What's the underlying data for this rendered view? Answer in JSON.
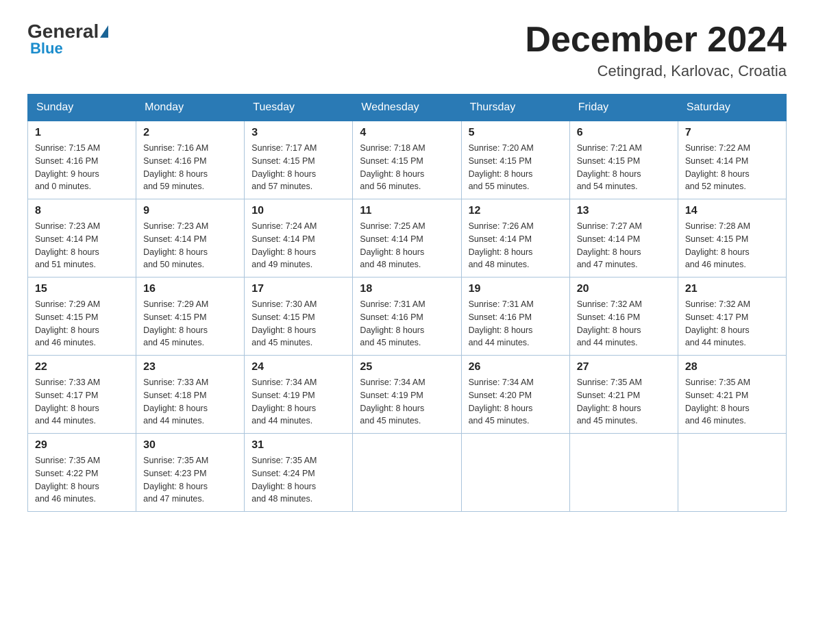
{
  "logo": {
    "general": "General",
    "blue": "Blue"
  },
  "title": {
    "month_year": "December 2024",
    "location": "Cetingrad, Karlovac, Croatia"
  },
  "headers": [
    "Sunday",
    "Monday",
    "Tuesday",
    "Wednesday",
    "Thursday",
    "Friday",
    "Saturday"
  ],
  "weeks": [
    [
      {
        "day": "1",
        "sunrise": "7:15 AM",
        "sunset": "4:16 PM",
        "daylight": "9 hours and 0 minutes."
      },
      {
        "day": "2",
        "sunrise": "7:16 AM",
        "sunset": "4:16 PM",
        "daylight": "8 hours and 59 minutes."
      },
      {
        "day": "3",
        "sunrise": "7:17 AM",
        "sunset": "4:15 PM",
        "daylight": "8 hours and 57 minutes."
      },
      {
        "day": "4",
        "sunrise": "7:18 AM",
        "sunset": "4:15 PM",
        "daylight": "8 hours and 56 minutes."
      },
      {
        "day": "5",
        "sunrise": "7:20 AM",
        "sunset": "4:15 PM",
        "daylight": "8 hours and 55 minutes."
      },
      {
        "day": "6",
        "sunrise": "7:21 AM",
        "sunset": "4:15 PM",
        "daylight": "8 hours and 54 minutes."
      },
      {
        "day": "7",
        "sunrise": "7:22 AM",
        "sunset": "4:14 PM",
        "daylight": "8 hours and 52 minutes."
      }
    ],
    [
      {
        "day": "8",
        "sunrise": "7:23 AM",
        "sunset": "4:14 PM",
        "daylight": "8 hours and 51 minutes."
      },
      {
        "day": "9",
        "sunrise": "7:23 AM",
        "sunset": "4:14 PM",
        "daylight": "8 hours and 50 minutes."
      },
      {
        "day": "10",
        "sunrise": "7:24 AM",
        "sunset": "4:14 PM",
        "daylight": "8 hours and 49 minutes."
      },
      {
        "day": "11",
        "sunrise": "7:25 AM",
        "sunset": "4:14 PM",
        "daylight": "8 hours and 48 minutes."
      },
      {
        "day": "12",
        "sunrise": "7:26 AM",
        "sunset": "4:14 PM",
        "daylight": "8 hours and 48 minutes."
      },
      {
        "day": "13",
        "sunrise": "7:27 AM",
        "sunset": "4:14 PM",
        "daylight": "8 hours and 47 minutes."
      },
      {
        "day": "14",
        "sunrise": "7:28 AM",
        "sunset": "4:15 PM",
        "daylight": "8 hours and 46 minutes."
      }
    ],
    [
      {
        "day": "15",
        "sunrise": "7:29 AM",
        "sunset": "4:15 PM",
        "daylight": "8 hours and 46 minutes."
      },
      {
        "day": "16",
        "sunrise": "7:29 AM",
        "sunset": "4:15 PM",
        "daylight": "8 hours and 45 minutes."
      },
      {
        "day": "17",
        "sunrise": "7:30 AM",
        "sunset": "4:15 PM",
        "daylight": "8 hours and 45 minutes."
      },
      {
        "day": "18",
        "sunrise": "7:31 AM",
        "sunset": "4:16 PM",
        "daylight": "8 hours and 45 minutes."
      },
      {
        "day": "19",
        "sunrise": "7:31 AM",
        "sunset": "4:16 PM",
        "daylight": "8 hours and 44 minutes."
      },
      {
        "day": "20",
        "sunrise": "7:32 AM",
        "sunset": "4:16 PM",
        "daylight": "8 hours and 44 minutes."
      },
      {
        "day": "21",
        "sunrise": "7:32 AM",
        "sunset": "4:17 PM",
        "daylight": "8 hours and 44 minutes."
      }
    ],
    [
      {
        "day": "22",
        "sunrise": "7:33 AM",
        "sunset": "4:17 PM",
        "daylight": "8 hours and 44 minutes."
      },
      {
        "day": "23",
        "sunrise": "7:33 AM",
        "sunset": "4:18 PM",
        "daylight": "8 hours and 44 minutes."
      },
      {
        "day": "24",
        "sunrise": "7:34 AM",
        "sunset": "4:19 PM",
        "daylight": "8 hours and 44 minutes."
      },
      {
        "day": "25",
        "sunrise": "7:34 AM",
        "sunset": "4:19 PM",
        "daylight": "8 hours and 45 minutes."
      },
      {
        "day": "26",
        "sunrise": "7:34 AM",
        "sunset": "4:20 PM",
        "daylight": "8 hours and 45 minutes."
      },
      {
        "day": "27",
        "sunrise": "7:35 AM",
        "sunset": "4:21 PM",
        "daylight": "8 hours and 45 minutes."
      },
      {
        "day": "28",
        "sunrise": "7:35 AM",
        "sunset": "4:21 PM",
        "daylight": "8 hours and 46 minutes."
      }
    ],
    [
      {
        "day": "29",
        "sunrise": "7:35 AM",
        "sunset": "4:22 PM",
        "daylight": "8 hours and 46 minutes."
      },
      {
        "day": "30",
        "sunrise": "7:35 AM",
        "sunset": "4:23 PM",
        "daylight": "8 hours and 47 minutes."
      },
      {
        "day": "31",
        "sunrise": "7:35 AM",
        "sunset": "4:24 PM",
        "daylight": "8 hours and 48 minutes."
      },
      null,
      null,
      null,
      null
    ]
  ],
  "labels": {
    "sunrise": "Sunrise:",
    "sunset": "Sunset:",
    "daylight": "Daylight:"
  }
}
